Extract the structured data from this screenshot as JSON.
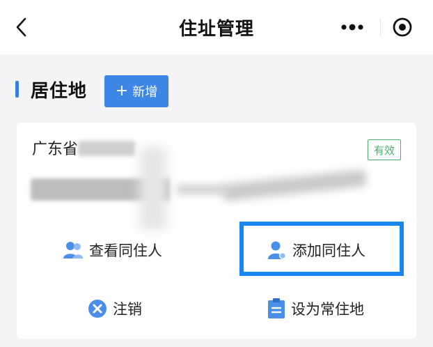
{
  "navbar": {
    "title": "住址管理",
    "back_icon": "chevron-left-icon",
    "more_icon": "more-dots-icon",
    "close_icon": "target-close-icon"
  },
  "section": {
    "title": "居住地",
    "add_button": {
      "icon": "plus-icon",
      "label": "新增"
    }
  },
  "card": {
    "province": "广东省",
    "status_badge": "有效",
    "actions": [
      {
        "label": "查看同住人",
        "icon": "people-icon"
      },
      {
        "label": "添加同住人",
        "icon": "add-person-icon"
      },
      {
        "label": "注销",
        "icon": "cancel-circle-icon"
      },
      {
        "label": "设为常住地",
        "icon": "clipboard-icon"
      }
    ]
  },
  "colors": {
    "accent": "#3d86e6",
    "badge_green": "#45b36b",
    "highlight_border": "#1a86f0"
  }
}
